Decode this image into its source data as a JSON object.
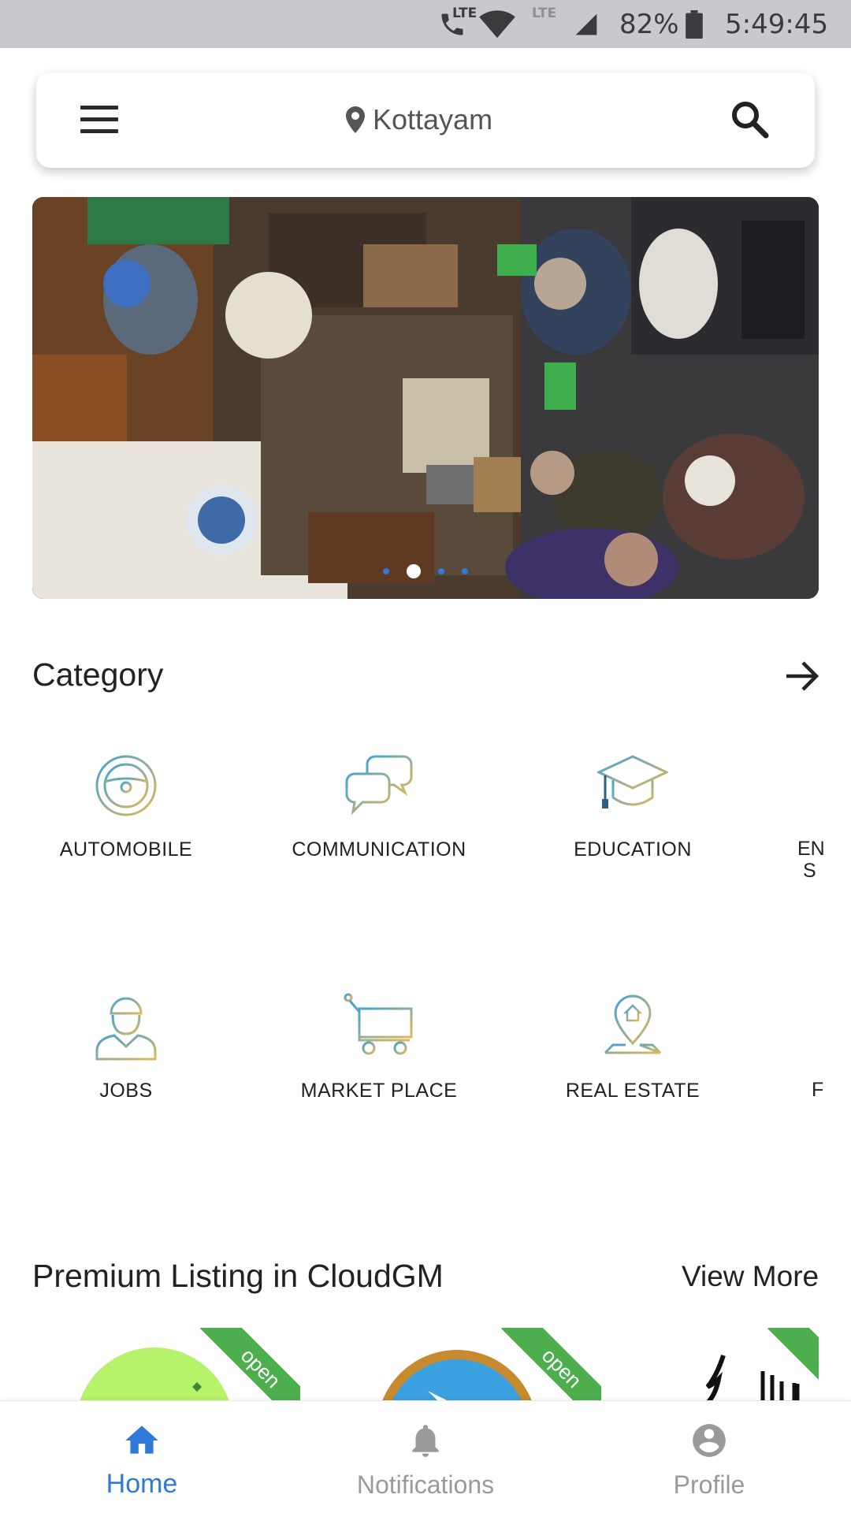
{
  "status_bar": {
    "call_lte": "LTE",
    "data_lte": "LTE",
    "battery": "82%",
    "time": "5:49:45"
  },
  "search_bar": {
    "location": "Kottayam"
  },
  "banner": {
    "slide_count": 4,
    "active_slide": 2
  },
  "category": {
    "title": "Category",
    "items": [
      {
        "label": "AUTOMOBILE",
        "icon": "steering-wheel-icon"
      },
      {
        "label": "COMMUNICATION",
        "icon": "chat-bubbles-icon"
      },
      {
        "label": "EDUCATION",
        "icon": "graduation-cap-icon"
      },
      {
        "label": "JOBS",
        "icon": "worker-icon"
      },
      {
        "label": "MARKET PLACE",
        "icon": "cart-icon"
      },
      {
        "label": "REAL ESTATE",
        "icon": "house-pin-icon"
      }
    ],
    "partial_items": [
      "EN S",
      "F"
    ]
  },
  "premium": {
    "title": "Premium Listing in CloudGM",
    "view_more": "View More",
    "badge": "open"
  },
  "bottom_nav": {
    "items": [
      {
        "label": "Home",
        "icon": "home-icon"
      },
      {
        "label": "Notifications",
        "icon": "bell-icon"
      },
      {
        "label": "Profile",
        "icon": "profile-icon"
      }
    ],
    "active": "Home"
  },
  "colors": {
    "accent": "#2f7ad8",
    "nav_inactive": "#9a9a9a",
    "ribbon": "#4cae4c",
    "icon_blue": "#3fa3d8",
    "icon_gold": "#e0b85a"
  }
}
